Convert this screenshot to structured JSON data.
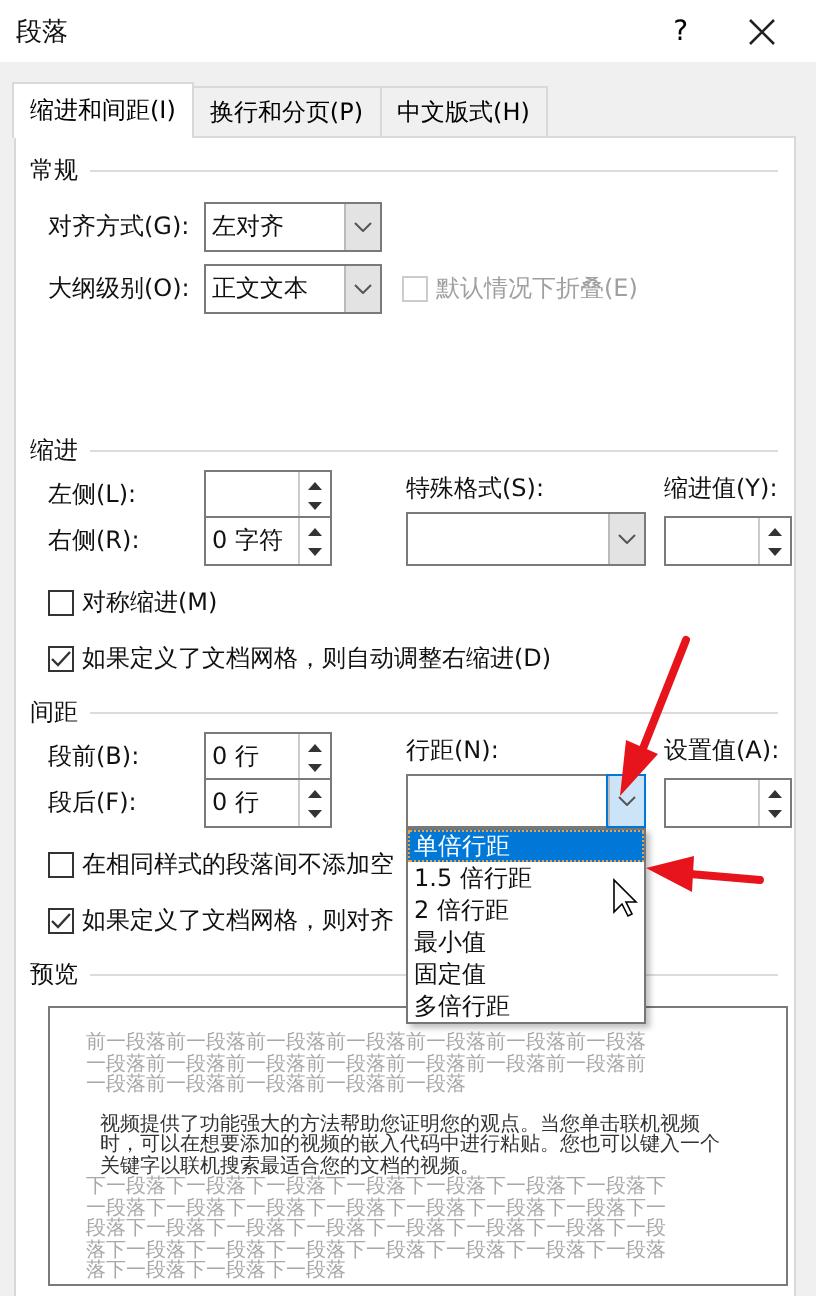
{
  "window": {
    "title": "段落",
    "help": "?"
  },
  "tabs": [
    {
      "label": "缩进和间距(I)",
      "selected": true
    },
    {
      "label": "换行和分页(P)",
      "selected": false
    },
    {
      "label": "中文版式(H)",
      "selected": false
    }
  ],
  "general": {
    "title": "常规",
    "alignment": {
      "label": "对齐方式(G):",
      "value": "左对齐"
    },
    "outline": {
      "label": "大纲级别(O):",
      "value": "正文文本"
    },
    "collapse": {
      "label": "默认情况下折叠(E)",
      "checked": false,
      "disabled": true
    }
  },
  "indent": {
    "title": "缩进",
    "left": {
      "label": "左侧(L):"
    },
    "right": {
      "label": "右侧(R):",
      "value": "0 字符"
    },
    "special": {
      "label": "特殊格式(S):"
    },
    "by": {
      "label": "缩进值(Y):"
    },
    "checkboxes": [
      {
        "label": "对称缩进(M)",
        "checked": false
      },
      {
        "label": "如果定义了文档网格，则自动调整右缩进(D)",
        "checked": true
      }
    ]
  },
  "spacing": {
    "title": "间距",
    "before": {
      "label": "段前(B):",
      "value": "0 行"
    },
    "after": {
      "label": "段后(F):",
      "value": "0 行"
    },
    "line_spacing": {
      "label": "行距(N):",
      "expanded": true,
      "options": [
        {
          "label": "单倍行距",
          "selected": true
        },
        {
          "label": "1.5 倍行距",
          "selected": false
        },
        {
          "label": "2 倍行距",
          "selected": false
        },
        {
          "label": "最小值",
          "selected": false
        },
        {
          "label": "固定值",
          "selected": false
        },
        {
          "label": "多倍行距",
          "selected": false
        }
      ]
    },
    "at": {
      "label": "设置值(A):"
    },
    "checkboxes": [
      {
        "label": "在相同样式的段落间不添加空",
        "checked": false
      },
      {
        "label": "如果定义了文档网格，则对齐",
        "checked": true
      }
    ]
  },
  "preview": {
    "title": "预览",
    "lines": [
      {
        "kind": "context",
        "text": "前一段落前一段落前一段落前一段落前一段落前一段落前一段落"
      },
      {
        "kind": "context",
        "text": "一段落前一段落前一段落前一段落前一段落前一段落前一段落前"
      },
      {
        "kind": "context",
        "text": "一段落前一段落前一段落前一段落前一段落"
      },
      {
        "kind": "body",
        "text": "视频提供了功能强大的方法帮助您证明您的观点。当您单击联机视频时，可以在想要添加的视频的嵌入代码中进行粘贴。您也可以键入一个关键字以联机搜索最适合您的文档的视频。"
      },
      {
        "kind": "context",
        "text": "下一段落下一段落下一段落下一段落下一段落下一段落下一段落下"
      },
      {
        "kind": "context",
        "text": "一段落下一段落下一段落下一段落下一段落下一段落下一段落下一"
      },
      {
        "kind": "context",
        "text": "段落下一段落下一段落下一段落下一段落下一段落下一段落下一段"
      },
      {
        "kind": "context",
        "text": "落下一段落下一段落下一段落下一段落下一段落下一段落下一段落"
      },
      {
        "kind": "context",
        "text": "落下一段落下一段落下一段落"
      }
    ]
  }
}
